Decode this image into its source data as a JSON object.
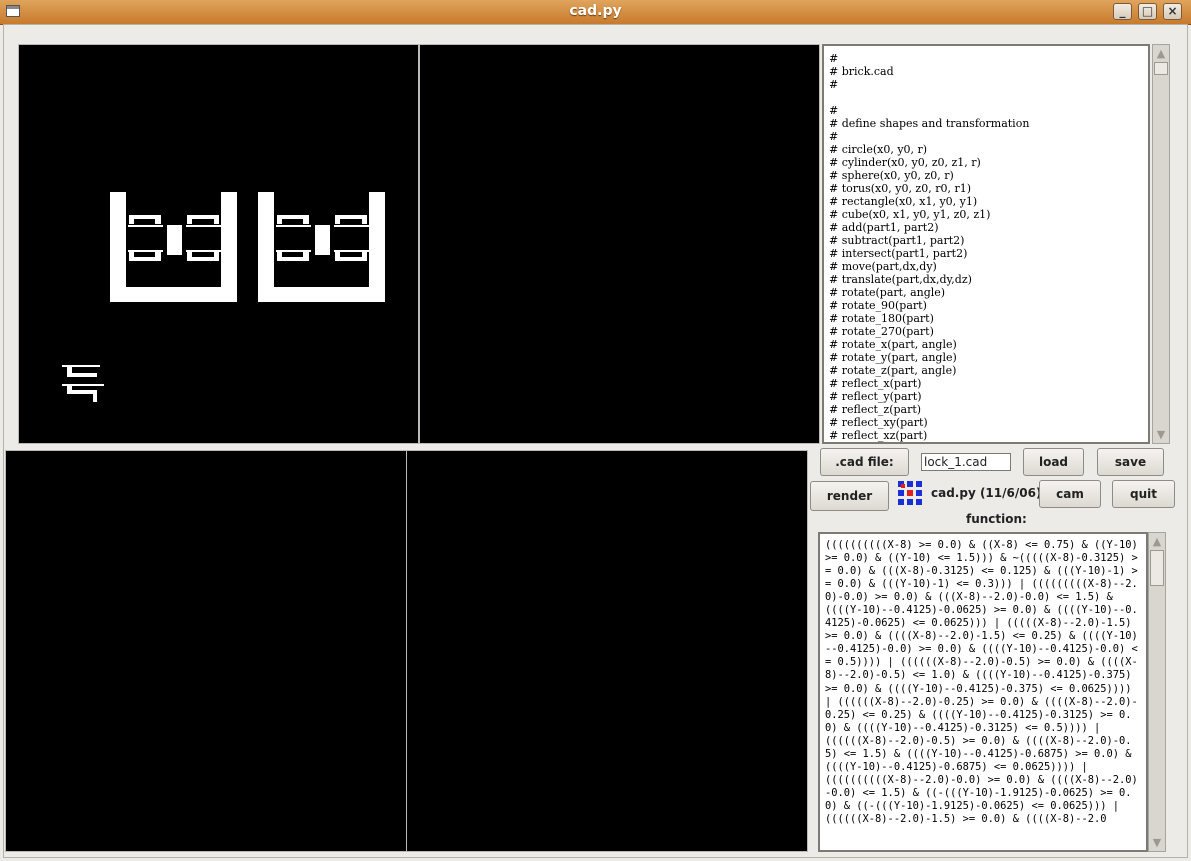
{
  "window": {
    "title": "cad.py",
    "minimize": "_",
    "maximize": "□",
    "close": "×"
  },
  "script_text": "#\n# brick.cad\n#\n\n#\n# define shapes and transformation\n#\n# circle(x0, y0, r)\n# cylinder(x0, y0, z0, z1, r)\n# sphere(x0, y0, z0, r)\n# torus(x0, y0, z0, r0, r1)\n# rectangle(x0, x1, y0, y1)\n# cube(x0, x1, y0, y1, z0, z1)\n# add(part1, part2)\n# subtract(part1, part2)\n# intersect(part1, part2)\n# move(part,dx,dy)\n# translate(part,dx,dy,dz)\n# rotate(part, angle)\n# rotate_90(part)\n# rotate_180(part)\n# rotate_270(part)\n# rotate_x(part, angle)\n# rotate_y(part, angle)\n# rotate_z(part, angle)\n# reflect_x(part)\n# reflect_y(part)\n# reflect_z(part)\n# reflect_xy(part)\n# reflect_xz(part)",
  "controls": {
    "cad_file_label": ".cad file:",
    "cad_file_value": "lock_1.cad",
    "load_label": "load",
    "save_label": "save",
    "render_label": "render",
    "app_version": "cad.py  (11/6/06)",
    "cam_label": "cam",
    "quit_label": "quit",
    "function_label": "function:"
  },
  "function_text": "((((((((((X-8) >= 0.0) & ((X-8) <= 0.75) & ((Y-10) >= 0.0) & ((Y-10) <= 1.5))) & ~(((((X-8)-0.3125) >= 0.0) & (((X-8)-0.3125) <= 0.125) & (((Y-10)-1) >= 0.0) & (((Y-10)-1) <= 0.3))) | (((((((((X-8)--2.0)-0.0) >= 0.0) & (((X-8)--2.0)-0.0) <= 1.5) & ((((Y-10)--0.4125)-0.0625) >= 0.0) & ((((Y-10)--0.4125)-0.0625) <= 0.0625))) | (((((X-8)--2.0)-1.5) >= 0.0) & ((((X-8)--2.0)-1.5) <= 0.25) & ((((Y-10)--0.4125)-0.0) >= 0.0) & ((((Y-10)--0.4125)-0.0) <= 0.5)))) | ((((((X-8)--2.0)-0.5) >= 0.0) & ((((X-8)--2.0)-0.5) <= 1.0) & ((((Y-10)--0.4125)-0.375) >= 0.0) & ((((Y-10)--0.4125)-0.375) <= 0.0625)))) | ((((((X-8)--2.0)-0.25) >= 0.0) & ((((X-8)--2.0)-0.25) <= 0.25) & ((((Y-10)--0.4125)-0.3125) >= 0.0) & ((((Y-10)--0.4125)-0.3125) <= 0.5)))) | ((((((X-8)--2.0)-0.5) >= 0.0) & ((((X-8)--2.0)-0.5) <= 1.5) & ((((Y-10)--0.4125)-0.6875) >= 0.0) & ((((Y-10)--0.4125)-0.6875) <= 0.0625)))) | ((((((((((X-8)--2.0)-0.0) >= 0.0) & ((((X-8)--2.0)-0.0) <= 1.5) & ((-(((Y-10)-1.9125)-0.0625) >= 0.0) & ((-(((Y-10)-1.9125)-0.0625) <= 0.0625))) | ((((((X-8)--2.0)-1.5) >= 0.0) & ((((X-8)--2.0",
  "icons": {
    "app_icon_colors": [
      "#1a2fd6",
      "#e0201c"
    ]
  }
}
